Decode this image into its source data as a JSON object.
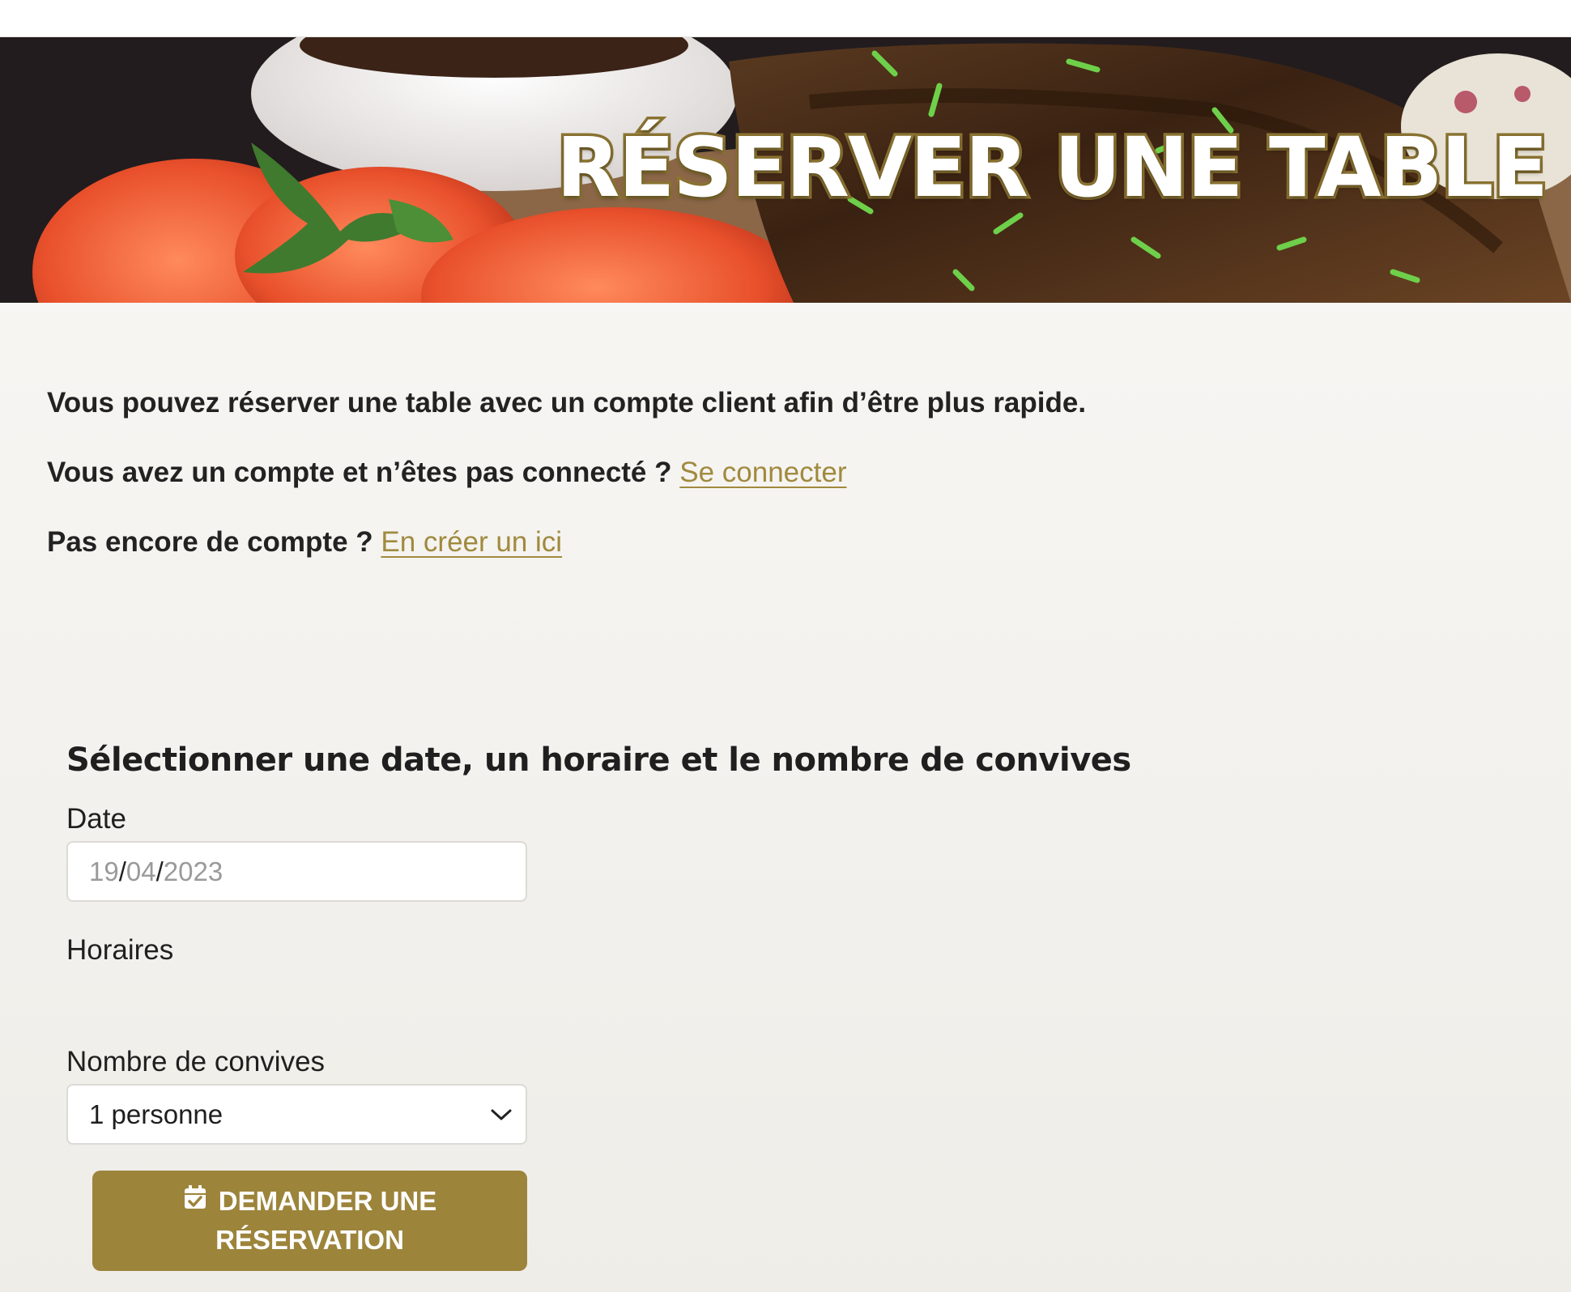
{
  "hero": {
    "title": "RÉSERVER UNE TABLE"
  },
  "intro": {
    "line1": "Vous pouvez réserver une table avec un compte client afin d’être plus rapide.",
    "line2_text": "Vous avez un compte et n’êtes pas connecté ? ",
    "line2_link": "Se connecter",
    "line3_text": "Pas encore de compte ? ",
    "line3_link": "En créer un ici"
  },
  "form": {
    "title": "Sélectionner une date, un horaire et le nombre de convives",
    "date_label": "Date",
    "date_day": "19",
    "date_month": "04",
    "date_year": "2023",
    "date_separator": "/",
    "horaires_label": "Horaires",
    "guests_label": "Nombre de convives",
    "guests_value": "1 personne",
    "submit_line1": "DEMANDER UNE",
    "submit_line2": "RÉSERVATION"
  },
  "colors": {
    "accent": "#9c843b",
    "link": "#a08a3e",
    "title_outline": "#8c7432"
  },
  "icons": {
    "submit": "calendar-check-icon",
    "select": "chevron-down-icon"
  }
}
